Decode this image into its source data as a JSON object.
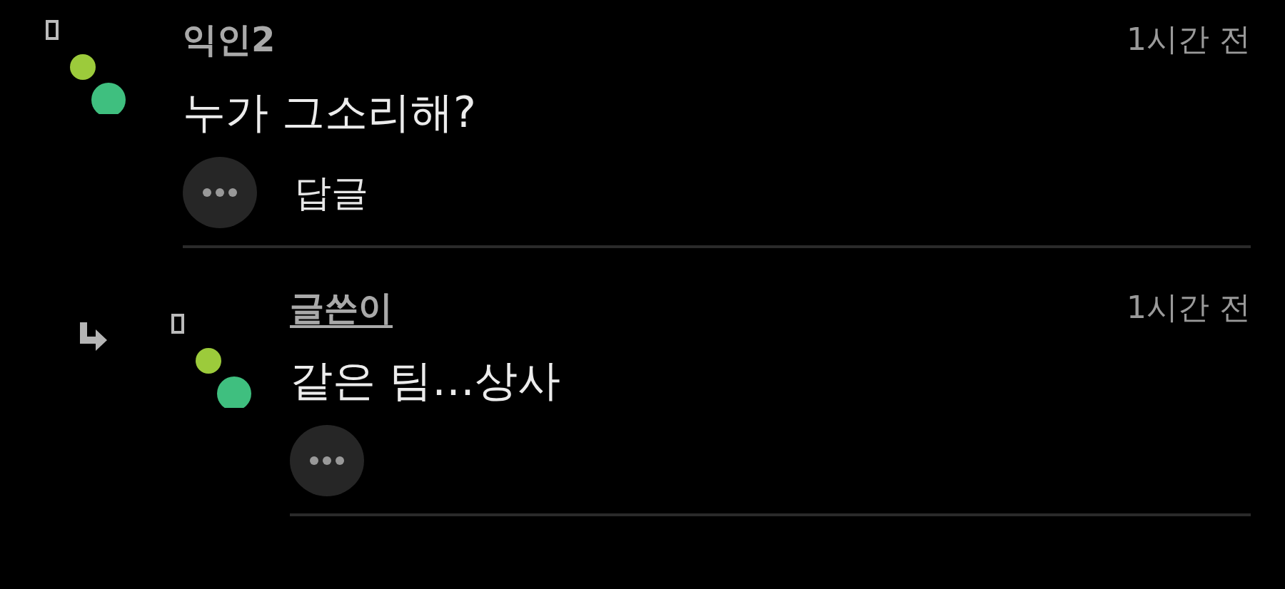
{
  "comments": [
    {
      "kind": "comment",
      "author": "익인2",
      "is_author": false,
      "time": "1시간 전",
      "body": "누가 그소리해?",
      "reply_label": "답글"
    },
    {
      "kind": "reply",
      "author": "글쓴이",
      "is_author": true,
      "time": "1시간 전",
      "body": "같은 팀…상사"
    }
  ]
}
